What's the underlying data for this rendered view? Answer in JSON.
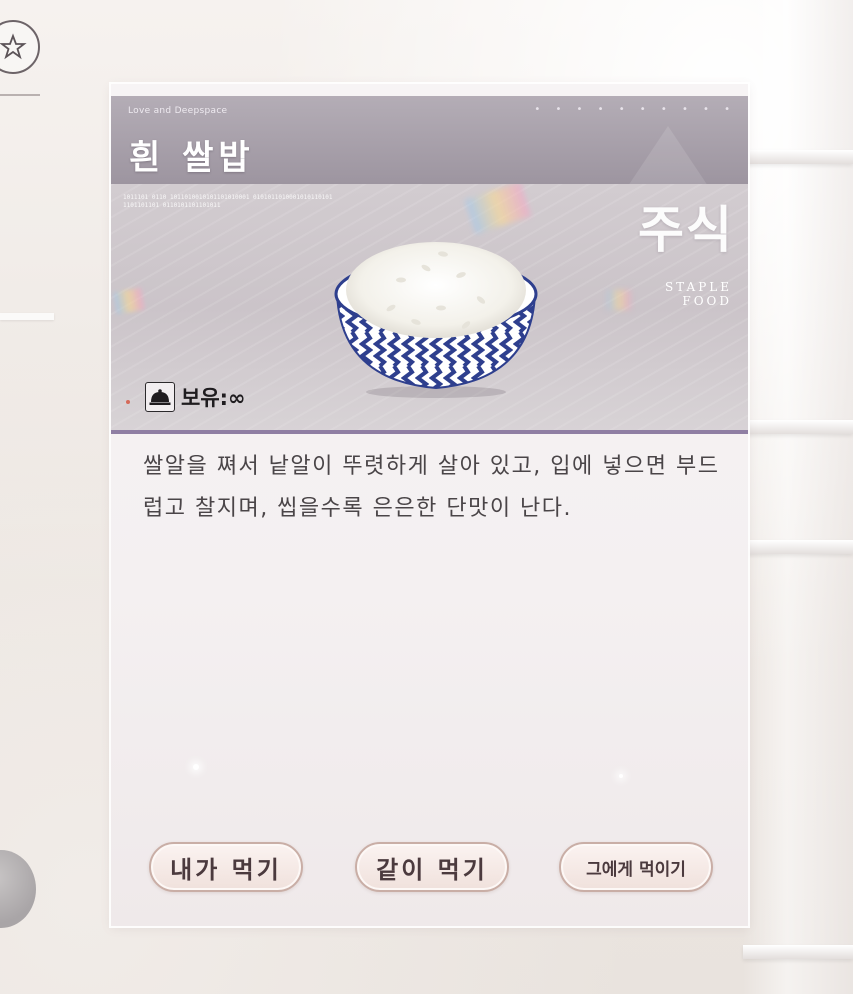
{
  "header": {
    "brand": "Love and Deepspace",
    "item_name": "흰 쌀밥"
  },
  "category": {
    "korean": "주식",
    "english_line1": "STAPLE",
    "english_line2": "FOOD"
  },
  "image": {
    "binary_line1": "1011101 0110   1011010010101101010001 0101011010001010110101",
    "binary_line2": "1101101101 0110101101101011"
  },
  "owned": {
    "label": "보유:∞",
    "icon": "cloche-icon"
  },
  "description": "쌀알을 쪄서 낱알이 뚜렷하게 살아 있고, 입에 넣으면 부드럽고 찰지며, 씹을수록 은은한 단맛이 난다.",
  "actions": {
    "eat_myself": "내가 먹기",
    "eat_together": "같이 먹기",
    "feed_him": "그에게 먹이기"
  },
  "colors": {
    "accent_line": "#8f7ea3",
    "header_bg": "#a49ca7",
    "button_border": "#c9aea6"
  }
}
